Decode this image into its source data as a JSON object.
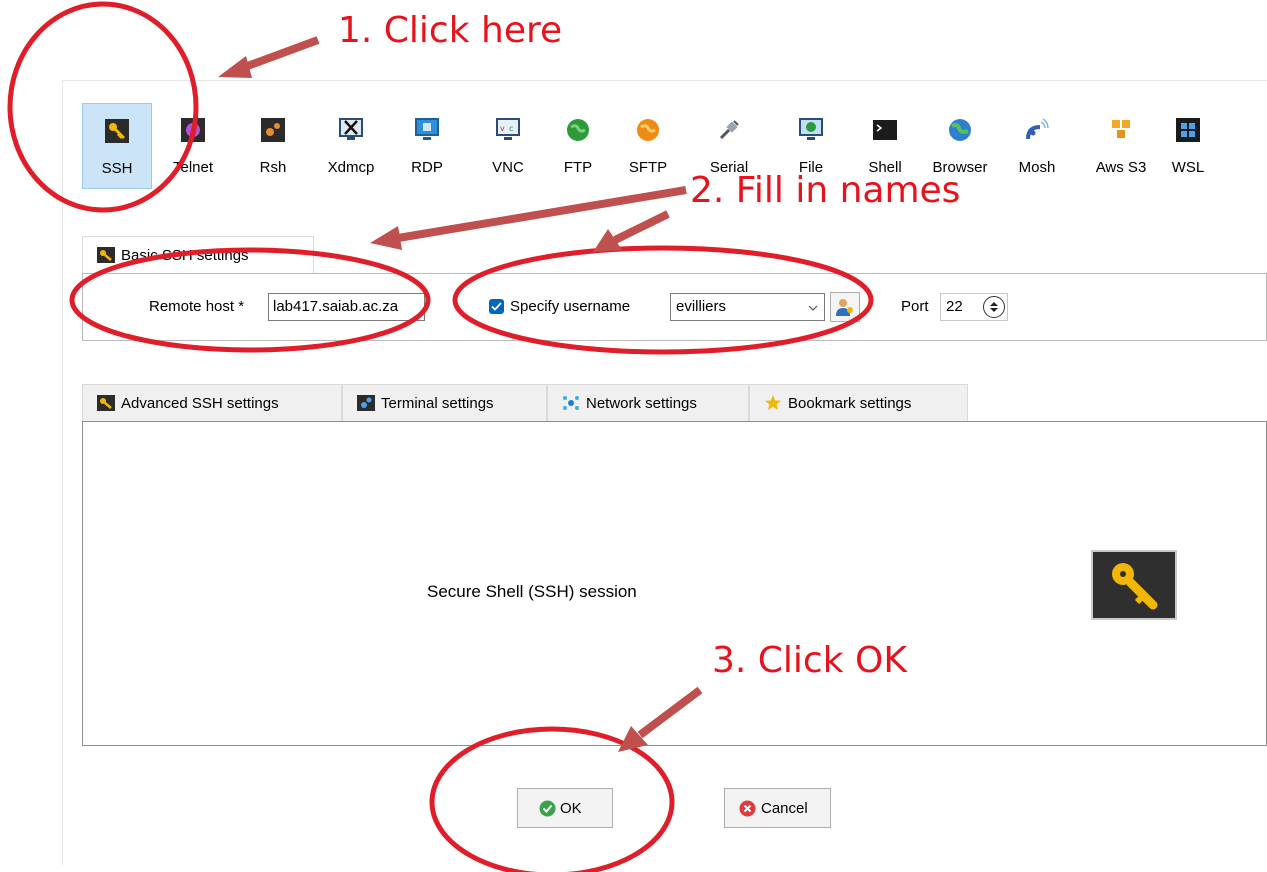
{
  "session_types": [
    {
      "label": "SSH",
      "icon": "key-icon",
      "active": true
    },
    {
      "label": "Telnet",
      "icon": "telnet-icon"
    },
    {
      "label": "Rsh",
      "icon": "rsh-icon"
    },
    {
      "label": "Xdmcp",
      "icon": "xdmcp-icon"
    },
    {
      "label": "RDP",
      "icon": "rdp-icon"
    },
    {
      "label": "VNC",
      "icon": "vnc-icon"
    },
    {
      "label": "FTP",
      "icon": "ftp-globe-icon"
    },
    {
      "label": "SFTP",
      "icon": "sftp-globe-icon"
    },
    {
      "label": "Serial",
      "icon": "serial-plug-icon"
    },
    {
      "label": "File",
      "icon": "file-monitor-icon"
    },
    {
      "label": "Shell",
      "icon": "shell-terminal-icon"
    },
    {
      "label": "Browser",
      "icon": "browser-globe-icon"
    },
    {
      "label": "Mosh",
      "icon": "mosh-satellite-icon"
    },
    {
      "label": "Aws S3",
      "icon": "aws-s3-cubes-icon"
    },
    {
      "label": "WSL",
      "icon": "windows-icon"
    }
  ],
  "basic": {
    "tab_label": "Basic SSH settings",
    "remote_host_label": "Remote host *",
    "remote_host_value": "lab417.saiab.ac.za",
    "specify_username_label": "Specify username",
    "specify_username_checked": true,
    "username_value": "evilliers",
    "port_label": "Port",
    "port_value": "22"
  },
  "tabs": [
    {
      "label": "Advanced SSH settings",
      "icon": "key-icon"
    },
    {
      "label": "Terminal settings",
      "icon": "terminal-icon"
    },
    {
      "label": "Network settings",
      "icon": "network-icon"
    },
    {
      "label": "Bookmark settings",
      "icon": "star-icon"
    }
  ],
  "main": {
    "description": "Secure Shell (SSH) session"
  },
  "buttons": {
    "ok": "OK",
    "cancel": "Cancel"
  },
  "annotations": {
    "step1": "1. Click here",
    "step2": "2. Fill in names",
    "step3": "3. Click OK"
  },
  "colors": {
    "annotation": "#e8121d",
    "arrow": "#c0504d",
    "active_tab": "#cce4f7",
    "key_yellow": "#f2b705"
  }
}
